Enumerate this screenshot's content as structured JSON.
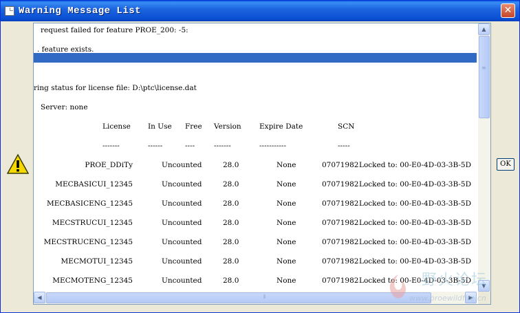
{
  "window": {
    "title": "Warning Message List",
    "close_label": "✕"
  },
  "ok_button": {
    "label": "OK"
  },
  "message": {
    "pre_lines": [
      "request failed for feature PROE_200: -5:",
      ". feature exists.",
      "",
      "",
      "ring status for license file: D:\\ptc\\license.dat",
      "Server: none"
    ],
    "selected_line_index": 2,
    "table_headers": [
      "License",
      "In Use",
      "Free",
      "Version",
      "Expire Date",
      "SCN"
    ],
    "table_separators": [
      "-------",
      "------",
      "----",
      "-------",
      "-----------",
      "-----"
    ],
    "rows": [
      {
        "license": "PROE_DDiTy",
        "in_use": "Uncounted",
        "version": "28.0",
        "expire": "None",
        "scn": "07071982",
        "locked": "Locked to: 00-E0-4D-03-3B-5D"
      },
      {
        "license": "MECBASICUI_12345",
        "in_use": "Uncounted",
        "version": "28.0",
        "expire": "None",
        "scn": "07071982",
        "locked": "Locked to: 00-E0-4D-03-3B-5D"
      },
      {
        "license": "MECBASICENG_12345",
        "in_use": "Uncounted",
        "version": "28.0",
        "expire": "None",
        "scn": "07071982",
        "locked": "Locked to: 00-E0-4D-03-3B-5D"
      },
      {
        "license": "MECSTRUCUI_12345",
        "in_use": "Uncounted",
        "version": "28.0",
        "expire": "None",
        "scn": "07071982",
        "locked": "Locked to: 00-E0-4D-03-3B-5D"
      },
      {
        "license": "MECSTRUCENG_12345",
        "in_use": "Uncounted",
        "version": "28.0",
        "expire": "None",
        "scn": "07071982",
        "locked": "Locked to: 00-E0-4D-03-3B-5D"
      },
      {
        "license": "MECMOTUI_12345",
        "in_use": "Uncounted",
        "version": "28.0",
        "expire": "None",
        "scn": "07071982",
        "locked": "Locked to: 00-E0-4D-03-3B-5D"
      },
      {
        "license": "MECMOTENG_12345",
        "in_use": "Uncounted",
        "version": "28.0",
        "expire": "None",
        "scn": "07071982",
        "locked": "Locked to: 00-E0-4D-03-3B-5D"
      }
    ]
  },
  "icons": {
    "title": "window-icon",
    "warning": "warning-icon",
    "scroll_up": "scroll-up-arrow-icon",
    "scroll_down": "scroll-down-arrow-icon",
    "scroll_left": "scroll-left-arrow-icon",
    "scroll_right": "scroll-right-arrow-icon"
  },
  "watermark": {
    "title": "野火论坛",
    "url": "www.proewildfire.cn"
  },
  "colors": {
    "title_bar": "#0a4fd2",
    "selection": "#316ac5",
    "window_bg": "#ece9d8"
  }
}
